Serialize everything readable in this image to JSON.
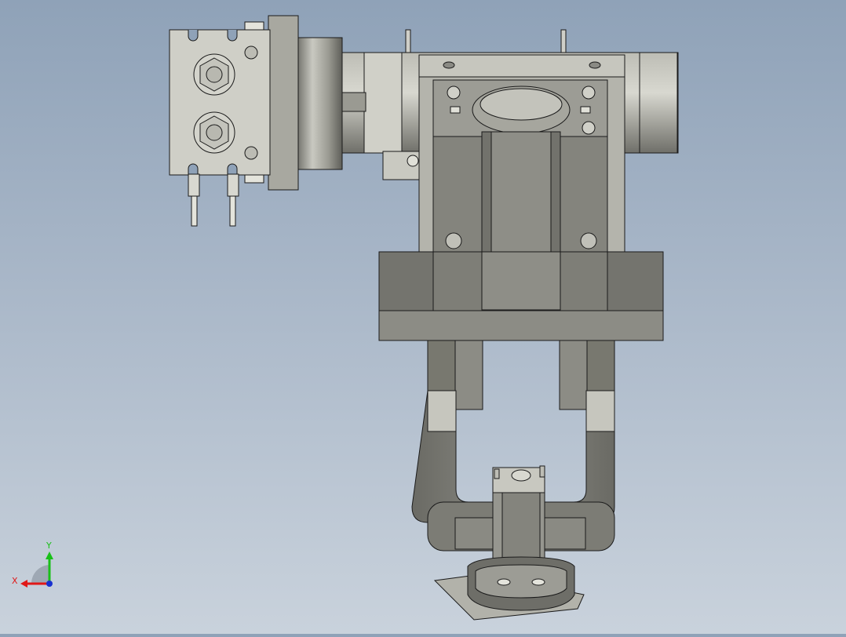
{
  "viewport": {
    "background_top": "#8fa2b8",
    "background_bottom": "#c9d2dc",
    "model_face_color": "#c8c8c0",
    "model_dark_color": "#7f7f78",
    "edge_color": "#1a1a1a"
  },
  "triad": {
    "x_label": "X",
    "y_label": "Y",
    "x_color": "#e01818",
    "y_color": "#18c018",
    "z_color": "#1830d0"
  }
}
